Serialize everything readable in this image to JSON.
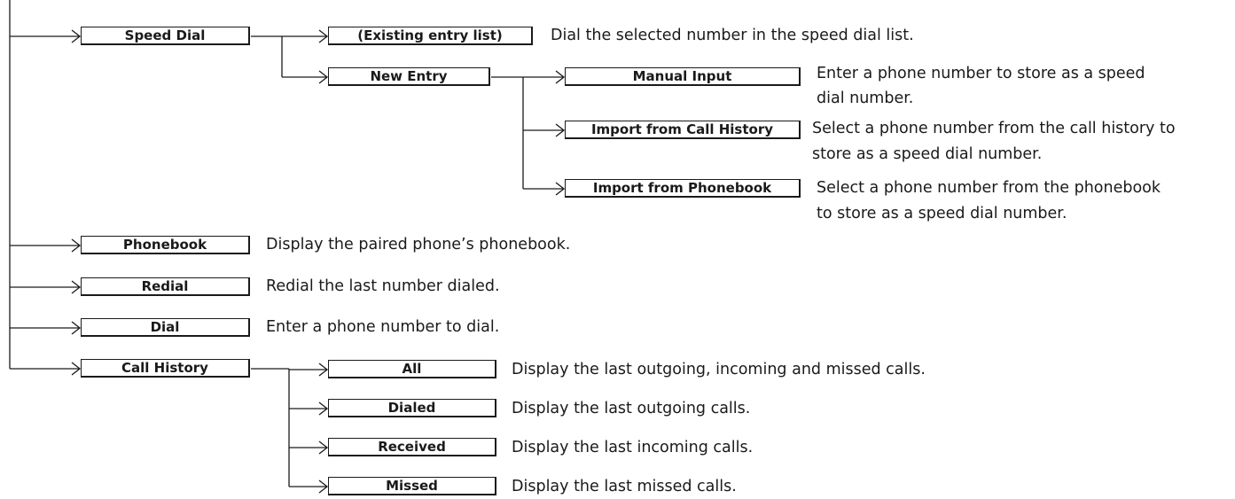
{
  "colors": {
    "line": "#1a1a1a",
    "text": "#1a1a1a",
    "background": "#ffffff"
  },
  "menu": {
    "speed_dial": {
      "label": "Speed Dial",
      "existing": {
        "label": "(Existing entry list)",
        "desc": "Dial the selected number in the speed dial list."
      },
      "new_entry": {
        "label": "New Entry",
        "manual_input": {
          "label": "Manual Input",
          "desc_line1": "Enter a phone number to store as a speed",
          "desc_line2": "dial number."
        },
        "import_call_history": {
          "label": "Import from Call History",
          "desc_line1": "Select a phone number from the call history to",
          "desc_line2": "store as a speed dial number."
        },
        "import_phonebook": {
          "label": "Import from Phonebook",
          "desc_line1": "Select a phone number from the phonebook",
          "desc_line2": "to store as a speed dial number."
        }
      }
    },
    "phonebook": {
      "label": "Phonebook",
      "desc": "Display the paired phone’s phonebook."
    },
    "redial": {
      "label": "Redial",
      "desc": "Redial the last number dialed."
    },
    "dial": {
      "label": "Dial",
      "desc": "Enter a phone number to dial."
    },
    "call_history": {
      "label": "Call History",
      "all": {
        "label": "All",
        "desc": "Display the last outgoing, incoming and missed calls."
      },
      "dialed": {
        "label": "Dialed",
        "desc": "Display the last outgoing calls."
      },
      "received": {
        "label": "Received",
        "desc": "Display the last incoming calls."
      },
      "missed": {
        "label": "Missed",
        "desc": "Display the last missed calls."
      }
    }
  }
}
